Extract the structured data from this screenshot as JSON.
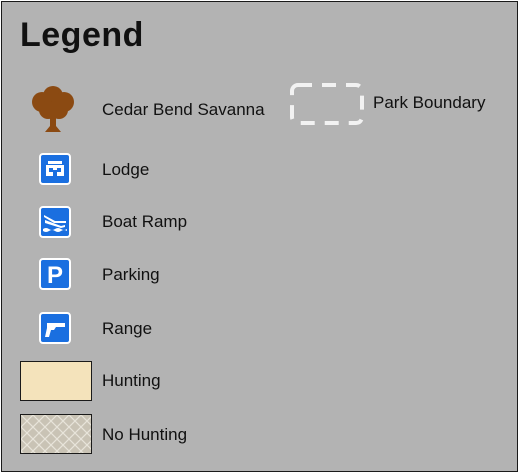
{
  "legend": {
    "title": "Legend",
    "colors": {
      "panel_background": "#b3b3b3",
      "panel_border": "#1a1a1a",
      "tree": "#8b4a12",
      "badge_blue": "#1a6fe0",
      "hunting_fill": "#f4e3bb",
      "no_hunting_fill": "#c9c3b5",
      "boundary_dash": "#f2f2f2"
    },
    "items": [
      {
        "label": "Cedar Bend Savanna",
        "icon": "tree-icon"
      },
      {
        "label": "Park Boundary",
        "icon": "dashed-boundary-icon"
      },
      {
        "label": "Lodge",
        "icon": "lodge-icon"
      },
      {
        "label": "Boat Ramp",
        "icon": "boat-ramp-icon"
      },
      {
        "label": "Parking",
        "icon": "parking-icon",
        "glyph": "P"
      },
      {
        "label": "Range",
        "icon": "range-icon"
      },
      {
        "label": "Hunting",
        "icon": "hunting-swatch"
      },
      {
        "label": "No Hunting",
        "icon": "no-hunting-swatch"
      }
    ]
  }
}
